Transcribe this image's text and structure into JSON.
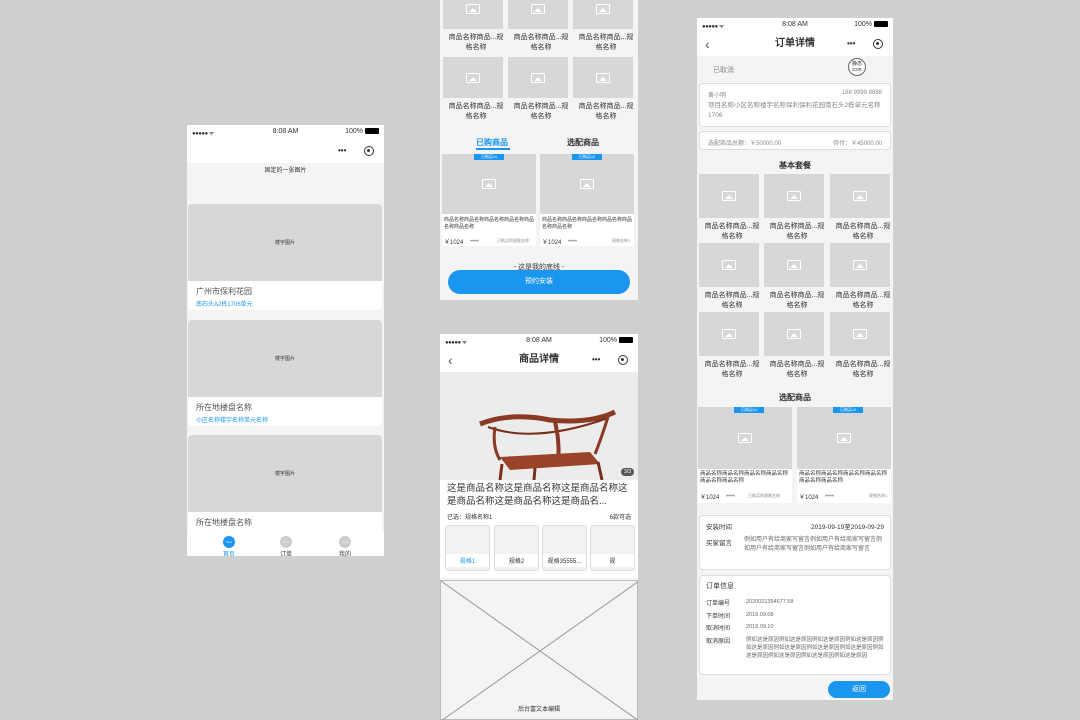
{
  "status": {
    "signal": "●●●●● ᯤ",
    "time": "8:08 AM",
    "battery": "100%"
  },
  "home": {
    "fixed_image": "固定的一张图片",
    "building_photo": "楼宇图片",
    "cards": [
      {
        "title": "广州市保利花园",
        "sub": "南石头A2栋1706单元"
      },
      {
        "title": "所在地楼盘名称",
        "sub": "小区名称楼宇名称单元名称"
      },
      {
        "title": "所在地楼盘名称",
        "sub": ""
      }
    ],
    "tabs": [
      {
        "icon": "icon",
        "label": "首页"
      },
      {
        "icon": "icon",
        "label": "订单"
      },
      {
        "icon": "icon",
        "label": "我的"
      }
    ]
  },
  "list": {
    "product_name_2line": [
      "商品名称商品...规",
      "格名称"
    ],
    "section_tabs": [
      "已购商品",
      "选配商品"
    ],
    "purchased": [
      {
        "tag": "已购买x1",
        "name": "商品名称商品名称商品名称商品名称商品名称商品名称",
        "price": "￥1024",
        "orig": "1999",
        "note": "已购买的规格名称"
      },
      {
        "tag": "已购买x2",
        "name": "商品名称商品名称商品名称商品名称商品名称商品名称",
        "price": "￥1024",
        "orig": "1999",
        "note": "规格名称1"
      }
    ],
    "bottom_line": "- 这是我的底线 -",
    "book_button": "预约安装"
  },
  "detail": {
    "title": "商品详情",
    "counter": "3/3",
    "name": "这是商品名称这是商品名称这是商品名称这是商品名称这是商品名称这是商品名...",
    "selected_label": "已选：",
    "selected_value": "规格名称1",
    "available": "6款可选",
    "specs": [
      "规格1",
      "规格2",
      "规格35555...",
      "规"
    ],
    "rich_text": "后台富文本编辑"
  },
  "order": {
    "title": "订单详情",
    "status": "已取消",
    "static_icon": "静态icon",
    "contact_name": "黄小明",
    "phone": "188 9999 8888",
    "address": "项目名称小区名称楼宇名称保利保利花园南石头2栋单元名称1706",
    "total_label": "选配商品总额：",
    "total": "￥50000.00",
    "pending_label": "待付：",
    "pending": "￥45000.00",
    "basic_title": "基本套餐",
    "product_name_2line": [
      "商品名称商品...规",
      "格名称"
    ],
    "optional_title": "选配商品",
    "optional": [
      {
        "tag": "已购买x1",
        "name": "商品名称商品名称商品名称商品名称商品名称商品名称",
        "price": "￥1024",
        "orig": "1999",
        "note": "已购买的规格名称"
      },
      {
        "tag": "已购买x2",
        "name": "商品名称商品名称商品名称商品名称商品名称商品名称",
        "price": "￥1024",
        "orig": "1999",
        "note": "规格名称1"
      }
    ],
    "install_label": "安装时间",
    "install_value": "2019-09-19至2019-09-29",
    "msg_label": "买家留言",
    "msg_value": "例如用户有给商家写留言例如用户有给商家写留言例如用户有给商家写留言例如用户有给商家写留言",
    "info_title": "订单信息",
    "rows": [
      {
        "label": "订单编号",
        "value": "2020021354677 58"
      },
      {
        "label": "下单时间",
        "value": "2019.09.08"
      },
      {
        "label": "取消时间",
        "value": "2019.09.10"
      },
      {
        "label": "取消原因",
        "value": "例如这是原因例如这是原因例如这是原因例如这是原因例如这是原因例如这是原因例如这是原因例如这是原因例如这是原因例如这是原因例如这是原因例如这是原因"
      }
    ],
    "return_button": "返回"
  }
}
